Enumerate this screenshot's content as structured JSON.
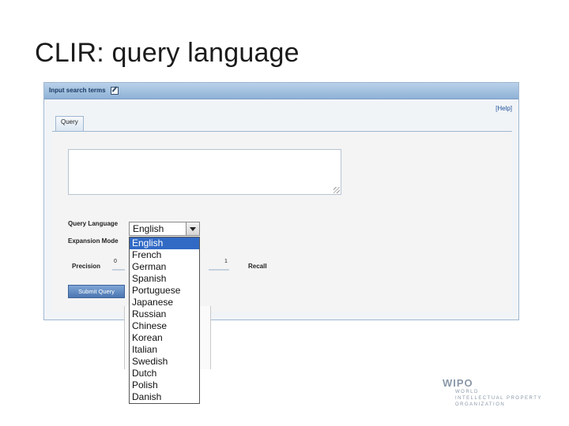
{
  "slide": {
    "title": "CLIR: query language"
  },
  "panel": {
    "header": "Input search terms",
    "help_link": "[Help]",
    "tab_label": "Query",
    "labels": {
      "query_language": "Query Language",
      "expansion_mode": "Expansion Mode",
      "precision": "Precision",
      "recall": "Recall"
    },
    "slider": {
      "min_value": "0",
      "max_value": "1"
    },
    "submit_label": "Submit Query",
    "language_select": {
      "selected": "English",
      "options": [
        "English",
        "French",
        "German",
        "Spanish",
        "Portuguese",
        "Japanese",
        "Russian",
        "Chinese",
        "Korean",
        "Italian",
        "Swedish",
        "Dutch",
        "Polish",
        "Danish"
      ]
    }
  },
  "logo": {
    "name": "WIPO",
    "lines": [
      "WORLD",
      "INTELLECTUAL PROPERTY",
      "ORGANIZATION"
    ]
  },
  "icons": [
    "edit-icon",
    "dropdown-arrow-icon",
    "resize-grip-icon"
  ],
  "colors": {
    "header_blue": "#8fb2d6",
    "selection": "#316ac5",
    "button": "#4b76b1"
  }
}
